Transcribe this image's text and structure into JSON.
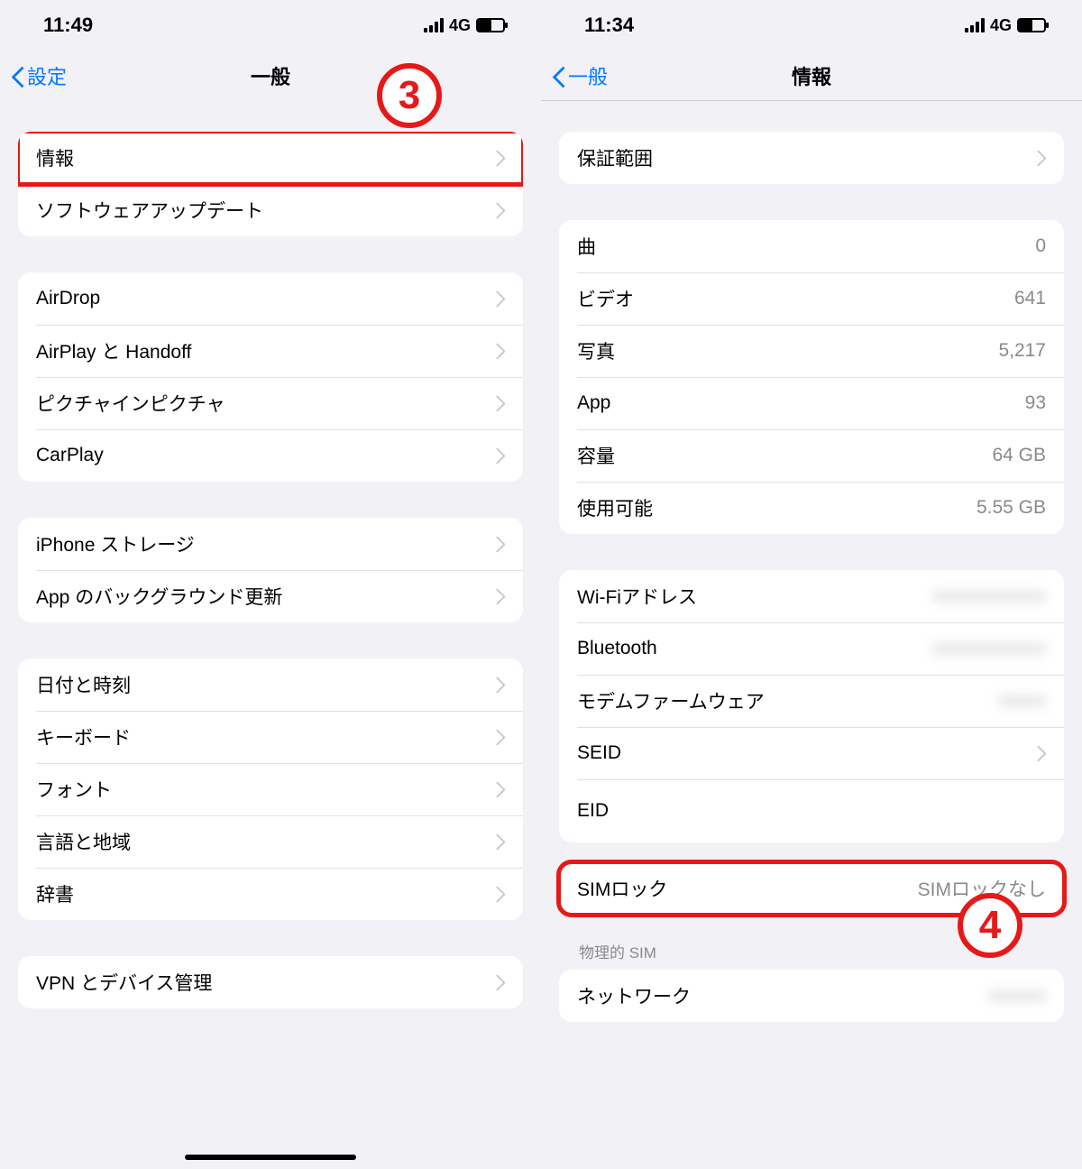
{
  "left": {
    "status": {
      "time": "11:49",
      "network": "4G"
    },
    "nav": {
      "back": "設定",
      "title": "一般"
    },
    "badge": "3",
    "groups": [
      [
        {
          "label": "情報",
          "chevron": true,
          "highlighted": true
        },
        {
          "label": "ソフトウェアアップデート",
          "chevron": true
        }
      ],
      [
        {
          "label": "AirDrop",
          "chevron": true
        },
        {
          "label": "AirPlay と Handoff",
          "chevron": true
        },
        {
          "label": "ピクチャインピクチャ",
          "chevron": true
        },
        {
          "label": "CarPlay",
          "chevron": true
        }
      ],
      [
        {
          "label": "iPhone ストレージ",
          "chevron": true
        },
        {
          "label": "App のバックグラウンド更新",
          "chevron": true
        }
      ],
      [
        {
          "label": "日付と時刻",
          "chevron": true
        },
        {
          "label": "キーボード",
          "chevron": true
        },
        {
          "label": "フォント",
          "chevron": true
        },
        {
          "label": "言語と地域",
          "chevron": true
        },
        {
          "label": "辞書",
          "chevron": true
        }
      ],
      [
        {
          "label": "VPN とデバイス管理",
          "chevron": true
        }
      ]
    ]
  },
  "right": {
    "status": {
      "time": "11:34",
      "network": "4G"
    },
    "nav": {
      "back": "一般",
      "title": "情報"
    },
    "badge": "4",
    "groups": [
      [
        {
          "label": "保証範囲",
          "chevron": true
        }
      ],
      [
        {
          "label": "曲",
          "value": "0"
        },
        {
          "label": "ビデオ",
          "value": "641"
        },
        {
          "label": "写真",
          "value": "5,217"
        },
        {
          "label": "App",
          "value": "93"
        },
        {
          "label": "容量",
          "value": "64 GB"
        },
        {
          "label": "使用可能",
          "value": "5.55 GB"
        }
      ],
      [
        {
          "label": "Wi-Fiアドレス",
          "value": "xxxxxxxxxxxx",
          "blur": true
        },
        {
          "label": "Bluetooth",
          "value": "xxxxxxxxxxxx",
          "blur": true
        },
        {
          "label": "モデムファームウェア",
          "value": "xxxxx",
          "blur": true
        },
        {
          "label": "SEID",
          "chevron": true
        },
        {
          "label": "EID",
          "value": ""
        }
      ],
      [
        {
          "label": "SIMロック",
          "value": "SIMロックなし",
          "highlighted": true
        }
      ]
    ],
    "sectionHeader": "物理的 SIM",
    "lastGroup": [
      {
        "label": "ネットワーク",
        "value": "xxxxxx",
        "blur": true
      }
    ]
  }
}
